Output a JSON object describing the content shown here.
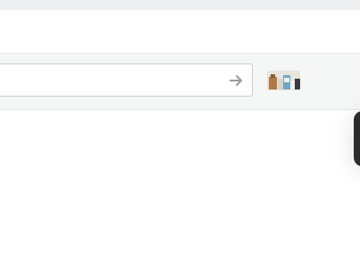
{
  "search": {
    "value": "",
    "submit_icon": "arrow-right-icon"
  },
  "thumbnail": {
    "icon": "product-image-thumbnail"
  },
  "colors": {
    "top_strip": "#eceef0",
    "toolbar_bg": "#f5f7f7",
    "input_border": "#c7cbcf",
    "arrow": "#9a9a9a",
    "side_handle": "#2b2b2b"
  }
}
